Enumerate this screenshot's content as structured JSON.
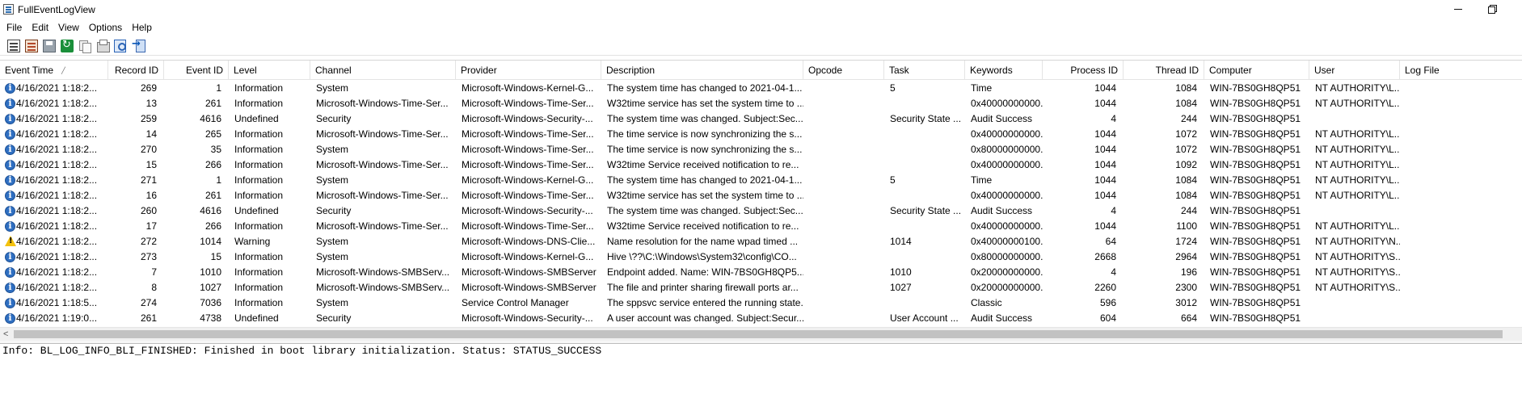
{
  "window": {
    "title": "FullEventLogView"
  },
  "menu": [
    "File",
    "Edit",
    "View",
    "Options",
    "Help"
  ],
  "toolbar": [
    {
      "name": "properties-icon"
    },
    {
      "name": "choose-data-source-icon"
    },
    {
      "name": "save-icon"
    },
    {
      "name": "refresh-icon"
    },
    {
      "name": "copy-icon"
    },
    {
      "name": "html-report-icon"
    },
    {
      "name": "find-icon"
    },
    {
      "name": "exit-icon"
    }
  ],
  "columns": {
    "event_time": "Event Time",
    "record_id": "Record ID",
    "event_id": "Event ID",
    "level": "Level",
    "channel": "Channel",
    "provider": "Provider",
    "description": "Description",
    "opcode": "Opcode",
    "task": "Task",
    "keywords": "Keywords",
    "process_id": "Process ID",
    "thread_id": "Thread ID",
    "computer": "Computer",
    "user": "User",
    "log_file": "Log File"
  },
  "sort_indicator": "╱",
  "events": [
    {
      "icon": "info",
      "time": "4/16/2021 1:18:2...",
      "record_id": "269",
      "event_id": "1",
      "level": "Information",
      "channel": "System",
      "provider": "Microsoft-Windows-Kernel-G...",
      "description": "The system time has changed to 2021-04-1...",
      "opcode": "",
      "task": "5",
      "keywords": "Time",
      "process_id": "1044",
      "thread_id": "1084",
      "computer": "WIN-7BS0GH8QP51",
      "user": "NT AUTHORITY\\L...",
      "log_file": ""
    },
    {
      "icon": "info",
      "time": "4/16/2021 1:18:2...",
      "record_id": "13",
      "event_id": "261",
      "level": "Information",
      "channel": "Microsoft-Windows-Time-Ser...",
      "provider": "Microsoft-Windows-Time-Ser...",
      "description": "W32time service has set the system time to ...",
      "opcode": "",
      "task": "",
      "keywords": "0x40000000000...",
      "process_id": "1044",
      "thread_id": "1084",
      "computer": "WIN-7BS0GH8QP51",
      "user": "NT AUTHORITY\\L...",
      "log_file": ""
    },
    {
      "icon": "info",
      "time": "4/16/2021 1:18:2...",
      "record_id": "259",
      "event_id": "4616",
      "level": "Undefined",
      "channel": "Security",
      "provider": "Microsoft-Windows-Security-...",
      "description": "The system time was changed. Subject:Sec...",
      "opcode": "",
      "task": "Security State ...",
      "keywords": "Audit Success",
      "process_id": "4",
      "thread_id": "244",
      "computer": "WIN-7BS0GH8QP51",
      "user": "",
      "log_file": ""
    },
    {
      "icon": "info",
      "time": "4/16/2021 1:18:2...",
      "record_id": "14",
      "event_id": "265",
      "level": "Information",
      "channel": "Microsoft-Windows-Time-Ser...",
      "provider": "Microsoft-Windows-Time-Ser...",
      "description": "The time service is now synchronizing the s...",
      "opcode": "",
      "task": "",
      "keywords": "0x40000000000...",
      "process_id": "1044",
      "thread_id": "1072",
      "computer": "WIN-7BS0GH8QP51",
      "user": "NT AUTHORITY\\L...",
      "log_file": ""
    },
    {
      "icon": "info",
      "time": "4/16/2021 1:18:2...",
      "record_id": "270",
      "event_id": "35",
      "level": "Information",
      "channel": "System",
      "provider": "Microsoft-Windows-Time-Ser...",
      "description": "The time service is now synchronizing the s...",
      "opcode": "",
      "task": "",
      "keywords": "0x80000000000...",
      "process_id": "1044",
      "thread_id": "1072",
      "computer": "WIN-7BS0GH8QP51",
      "user": "NT AUTHORITY\\L...",
      "log_file": ""
    },
    {
      "icon": "info",
      "time": "4/16/2021 1:18:2...",
      "record_id": "15",
      "event_id": "266",
      "level": "Information",
      "channel": "Microsoft-Windows-Time-Ser...",
      "provider": "Microsoft-Windows-Time-Ser...",
      "description": "W32time Service received notification to re...",
      "opcode": "",
      "task": "",
      "keywords": "0x40000000000...",
      "process_id": "1044",
      "thread_id": "1092",
      "computer": "WIN-7BS0GH8QP51",
      "user": "NT AUTHORITY\\L...",
      "log_file": ""
    },
    {
      "icon": "info",
      "time": "4/16/2021 1:18:2...",
      "record_id": "271",
      "event_id": "1",
      "level": "Information",
      "channel": "System",
      "provider": "Microsoft-Windows-Kernel-G...",
      "description": "The system time has changed to 2021-04-1...",
      "opcode": "",
      "task": "5",
      "keywords": "Time",
      "process_id": "1044",
      "thread_id": "1084",
      "computer": "WIN-7BS0GH8QP51",
      "user": "NT AUTHORITY\\L...",
      "log_file": ""
    },
    {
      "icon": "info",
      "time": "4/16/2021 1:18:2...",
      "record_id": "16",
      "event_id": "261",
      "level": "Information",
      "channel": "Microsoft-Windows-Time-Ser...",
      "provider": "Microsoft-Windows-Time-Ser...",
      "description": "W32time service has set the system time to ...",
      "opcode": "",
      "task": "",
      "keywords": "0x40000000000...",
      "process_id": "1044",
      "thread_id": "1084",
      "computer": "WIN-7BS0GH8QP51",
      "user": "NT AUTHORITY\\L...",
      "log_file": ""
    },
    {
      "icon": "info",
      "time": "4/16/2021 1:18:2...",
      "record_id": "260",
      "event_id": "4616",
      "level": "Undefined",
      "channel": "Security",
      "provider": "Microsoft-Windows-Security-...",
      "description": "The system time was changed. Subject:Sec...",
      "opcode": "",
      "task": "Security State ...",
      "keywords": "Audit Success",
      "process_id": "4",
      "thread_id": "244",
      "computer": "WIN-7BS0GH8QP51",
      "user": "",
      "log_file": ""
    },
    {
      "icon": "info",
      "time": "4/16/2021 1:18:2...",
      "record_id": "17",
      "event_id": "266",
      "level": "Information",
      "channel": "Microsoft-Windows-Time-Ser...",
      "provider": "Microsoft-Windows-Time-Ser...",
      "description": "W32time Service received notification to re...",
      "opcode": "",
      "task": "",
      "keywords": "0x40000000000...",
      "process_id": "1044",
      "thread_id": "1100",
      "computer": "WIN-7BS0GH8QP51",
      "user": "NT AUTHORITY\\L...",
      "log_file": ""
    },
    {
      "icon": "warning",
      "time": "4/16/2021 1:18:2...",
      "record_id": "272",
      "event_id": "1014",
      "level": "Warning",
      "channel": "System",
      "provider": "Microsoft-Windows-DNS-Clie...",
      "description": "Name resolution for the name wpad timed ...",
      "opcode": "",
      "task": "1014",
      "keywords": "0x40000000100...",
      "process_id": "64",
      "thread_id": "1724",
      "computer": "WIN-7BS0GH8QP51",
      "user": "NT AUTHORITY\\N...",
      "log_file": ""
    },
    {
      "icon": "info",
      "time": "4/16/2021 1:18:2...",
      "record_id": "273",
      "event_id": "15",
      "level": "Information",
      "channel": "System",
      "provider": "Microsoft-Windows-Kernel-G...",
      "description": "Hive \\??\\C:\\Windows\\System32\\config\\CO...",
      "opcode": "",
      "task": "",
      "keywords": "0x80000000000...",
      "process_id": "2668",
      "thread_id": "2964",
      "computer": "WIN-7BS0GH8QP51",
      "user": "NT AUTHORITY\\S...",
      "log_file": ""
    },
    {
      "icon": "info",
      "time": "4/16/2021 1:18:2...",
      "record_id": "7",
      "event_id": "1010",
      "level": "Information",
      "channel": "Microsoft-Windows-SMBServ...",
      "provider": "Microsoft-Windows-SMBServer",
      "description": "Endpoint added. Name: WIN-7BS0GH8QP5...",
      "opcode": "",
      "task": "1010",
      "keywords": "0x20000000000...",
      "process_id": "4",
      "thread_id": "196",
      "computer": "WIN-7BS0GH8QP51",
      "user": "NT AUTHORITY\\S...",
      "log_file": ""
    },
    {
      "icon": "info",
      "time": "4/16/2021 1:18:2...",
      "record_id": "8",
      "event_id": "1027",
      "level": "Information",
      "channel": "Microsoft-Windows-SMBServ...",
      "provider": "Microsoft-Windows-SMBServer",
      "description": "The file and printer sharing firewall ports ar...",
      "opcode": "",
      "task": "1027",
      "keywords": "0x20000000000...",
      "process_id": "2260",
      "thread_id": "2300",
      "computer": "WIN-7BS0GH8QP51",
      "user": "NT AUTHORITY\\S...",
      "log_file": ""
    },
    {
      "icon": "info",
      "time": "4/16/2021 1:18:5...",
      "record_id": "274",
      "event_id": "7036",
      "level": "Information",
      "channel": "System",
      "provider": "Service Control Manager",
      "description": "The sppsvc service entered the running state.",
      "opcode": "",
      "task": "",
      "keywords": "Classic",
      "process_id": "596",
      "thread_id": "3012",
      "computer": "WIN-7BS0GH8QP51",
      "user": "",
      "log_file": ""
    },
    {
      "icon": "info",
      "time": "4/16/2021 1:19:0...",
      "record_id": "261",
      "event_id": "4738",
      "level": "Undefined",
      "channel": "Security",
      "provider": "Microsoft-Windows-Security-...",
      "description": "A user account was changed. Subject:Secur...",
      "opcode": "",
      "task": "User Account ...",
      "keywords": "Audit Success",
      "process_id": "604",
      "thread_id": "664",
      "computer": "WIN-7BS0GH8QP51",
      "user": "",
      "log_file": ""
    }
  ],
  "scrollbar": {
    "left_arrow": "<"
  },
  "lower_pane": {
    "text": "Info: BL_LOG_INFO_BLI_FINISHED: Finished in boot library initialization. Status: STATUS_SUCCESS"
  }
}
